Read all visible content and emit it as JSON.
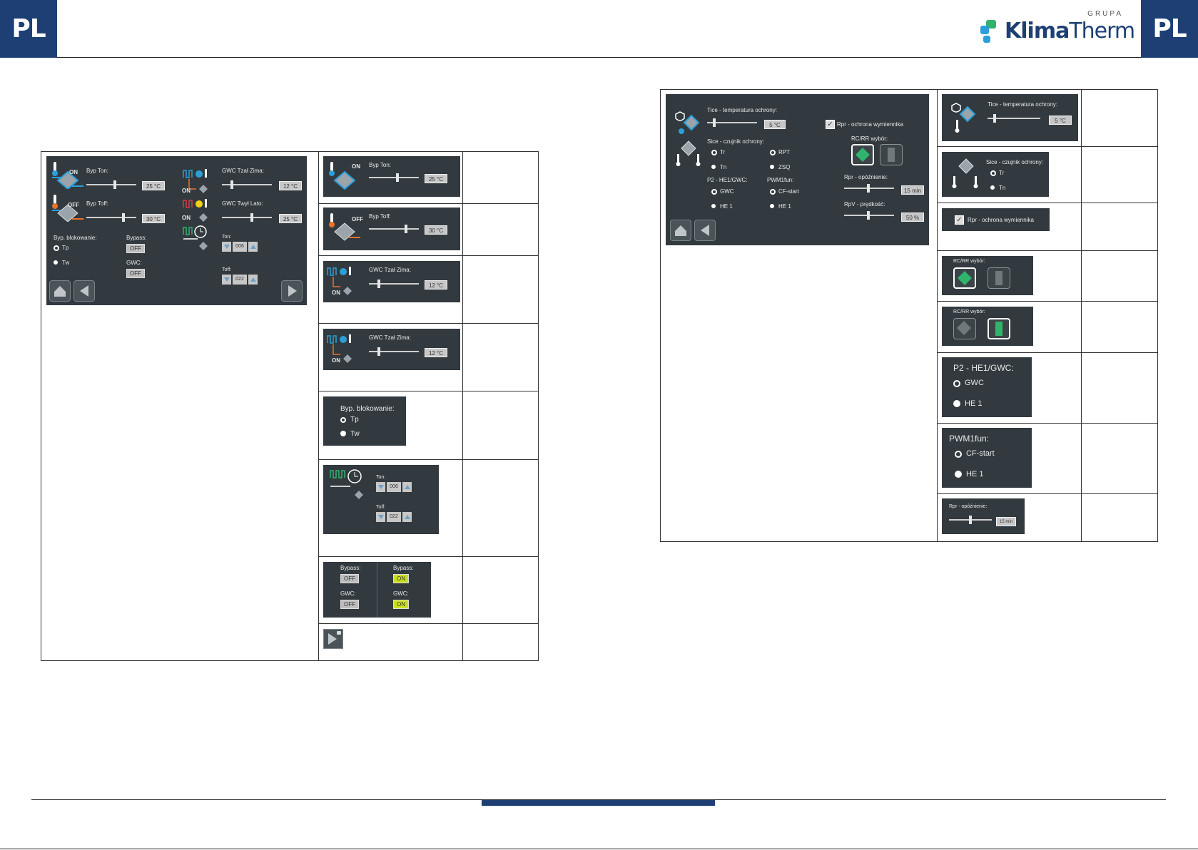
{
  "header": {
    "lang_left": "PL",
    "lang_right": "PL",
    "logo_group": "GRUPA",
    "logo_klima": "Klima",
    "logo_therm": "Therm"
  },
  "colors": {
    "navy": "#1d3f74",
    "panel": "#323a3f",
    "accent_green": "#2fb36d",
    "on_green": "#c9e021"
  },
  "left_main": {
    "byp_ton": "Byp Ton:",
    "byp_ton_val": "25 °C",
    "on": "ON",
    "byp_toff": "Byp Toff:",
    "byp_toff_val": "30 °C",
    "off": "OFF",
    "gwc_zima": "GWC Tzał Zima:",
    "gwc_zima_val": "12 °C",
    "gwc_lato": "GWC Twył Lato:",
    "gwc_lato_val": "25 °C",
    "blok": "Byp. blokowanie:",
    "tp": "Tp",
    "tw": "Tw",
    "bypass": "Bypass:",
    "bypass_val": "OFF",
    "gwc": "GWC:",
    "gwc_val": "OFF",
    "ton": "Ton:",
    "ton_val": "006",
    "toff": "Toff:",
    "toff_val": "022"
  },
  "left_crops": {
    "c1_label": "Byp Ton:",
    "c1_val": "25 °C",
    "c1_on": "ON",
    "c2_label": "Byp Toff:",
    "c2_val": "30 °C",
    "c2_off": "OFF",
    "c3_label": "GWC Tzał Zima:",
    "c3_val": "12 °C",
    "c3_on": "ON",
    "c4_label": "GWC Tzał Zima:",
    "c4_val": "12 °C",
    "c4_on": "ON",
    "c5_title": "Byp. blokowanie:",
    "c5_tp": "Tp",
    "c5_tw": "Tw",
    "c6_ton": "Ton:",
    "c6_ton_val": "006",
    "c6_toff": "Toff:",
    "c6_toff_val": "022",
    "c7_bypass_l": "Bypass:",
    "c7_bypass_l_val": "OFF",
    "c7_gwc_l": "GWC:",
    "c7_gwc_l_val": "OFF",
    "c7_bypass_r": "Bypass:",
    "c7_bypass_r_val": "ON",
    "c7_gwc_r": "GWC:",
    "c7_gwc_r_val": "ON"
  },
  "right_main": {
    "tice": "Tice - temperatura ochrony:",
    "tice_val": "5 °C",
    "rpr_chk": "Rpr - ochrona wymiennika",
    "sice": "Sice - czujnik ochrony:",
    "tr": "Tr",
    "rpt": "RPT",
    "tn": "Tn",
    "zsq": "ZSQ",
    "rcrr": "RC/RR wybór:",
    "p2": "P2 - HE1/GWC:",
    "p2_gwc": "GWC",
    "p2_he1": "HE 1",
    "pwm": "PWM1fun:",
    "pwm_cf": "CF-start",
    "pwm_he1": "HE 1",
    "rpr_op": "Rpr - opóźnienie:",
    "rpr_op_val": "15 min",
    "rpv": "RpV - prędkość:",
    "rpv_val": "50 %"
  },
  "right_crops": {
    "r1_label": "Tice - temperatura ochrony:",
    "r1_val": "5 °C",
    "r2_label": "Sice - czujnik ochrony:",
    "r2_tr": "Tr",
    "r2_tn": "Tn",
    "r3_label": "Rpr - ochrona wymiennika",
    "r4_label": "RC/RR wybór:",
    "r5_label": "RC/RR wybór:",
    "r6_title": "P2 - HE1/GWC:",
    "r6_gwc": "GWC",
    "r6_he1": "HE 1",
    "r7_title": "PWM1fun:",
    "r7_cf": "CF-start",
    "r7_he1": "HE 1",
    "r8_label": "Rpr - opóźnienie:",
    "r8_val": "15 min"
  }
}
